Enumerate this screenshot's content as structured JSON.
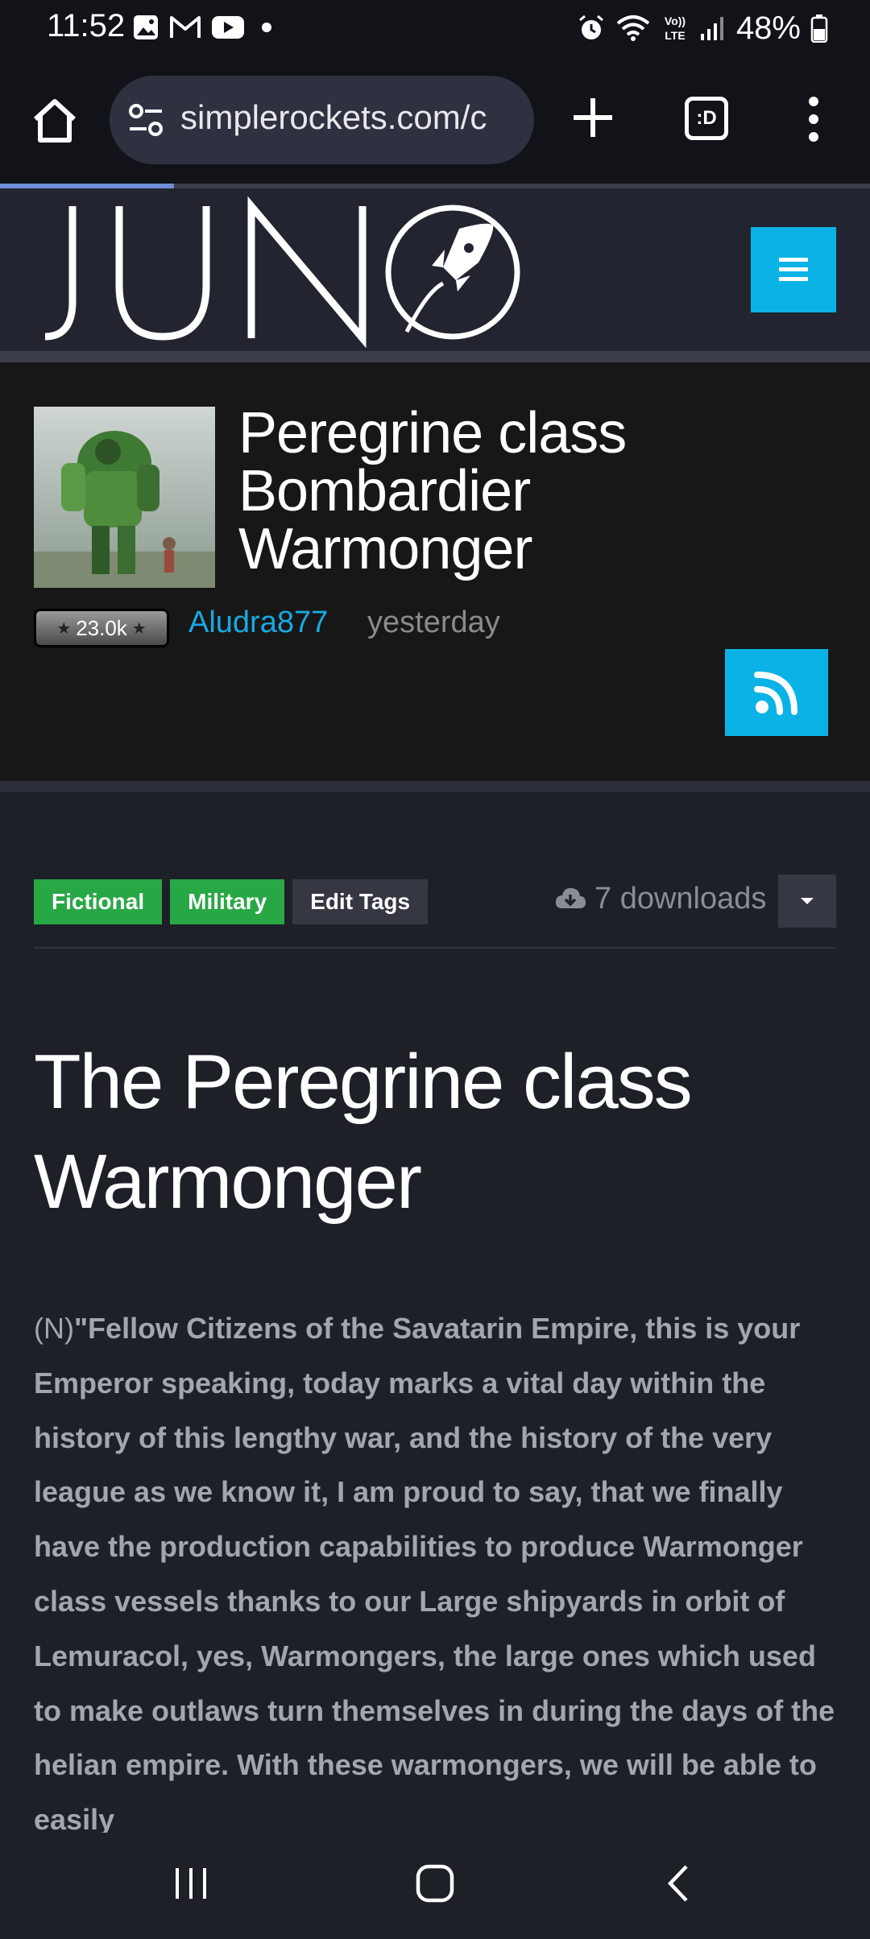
{
  "status_bar": {
    "time": "11:52",
    "battery": "48%",
    "network": "LTE",
    "left_icons": [
      "image-icon",
      "gmail-icon",
      "youtube-icon",
      "dot-icon"
    ],
    "right_icons": [
      "alarm-icon",
      "wifi-icon",
      "volte-icon",
      "signal-icon",
      "battery-icon"
    ]
  },
  "browser": {
    "url": "simplerockets.com/c",
    "tabs_label": ":D",
    "load_progress": 0.2
  },
  "site": {
    "logo_text": "JUNO",
    "accent_color": "#0bb2e6"
  },
  "craft": {
    "title": "Peregrine class Bombardier Warmonger",
    "author_badge": "23.0k",
    "author": "Aludra877",
    "posted": "yesterday"
  },
  "tags": {
    "items": [
      "Fictional",
      "Military"
    ],
    "edit_label": "Edit Tags"
  },
  "downloads": {
    "label": "7 downloads"
  },
  "article": {
    "heading": "The Peregrine class Warmonger",
    "prefix": "(N)",
    "body": "\"Fellow Citizens of the Savatarin Empire, this is your Emperor speaking, today marks a vital day within the history of this lengthy war, and the history of the very league as we know it, I am proud to say, that we finally have the production capabilities to produce Warmonger class vessels thanks to our Large shipyards in orbit of Lemuracol, yes, Warmongers, the large ones which used to make outlaws turn themselves in during the days of the helian empire. With these warmongers, we will be able to easily"
  }
}
